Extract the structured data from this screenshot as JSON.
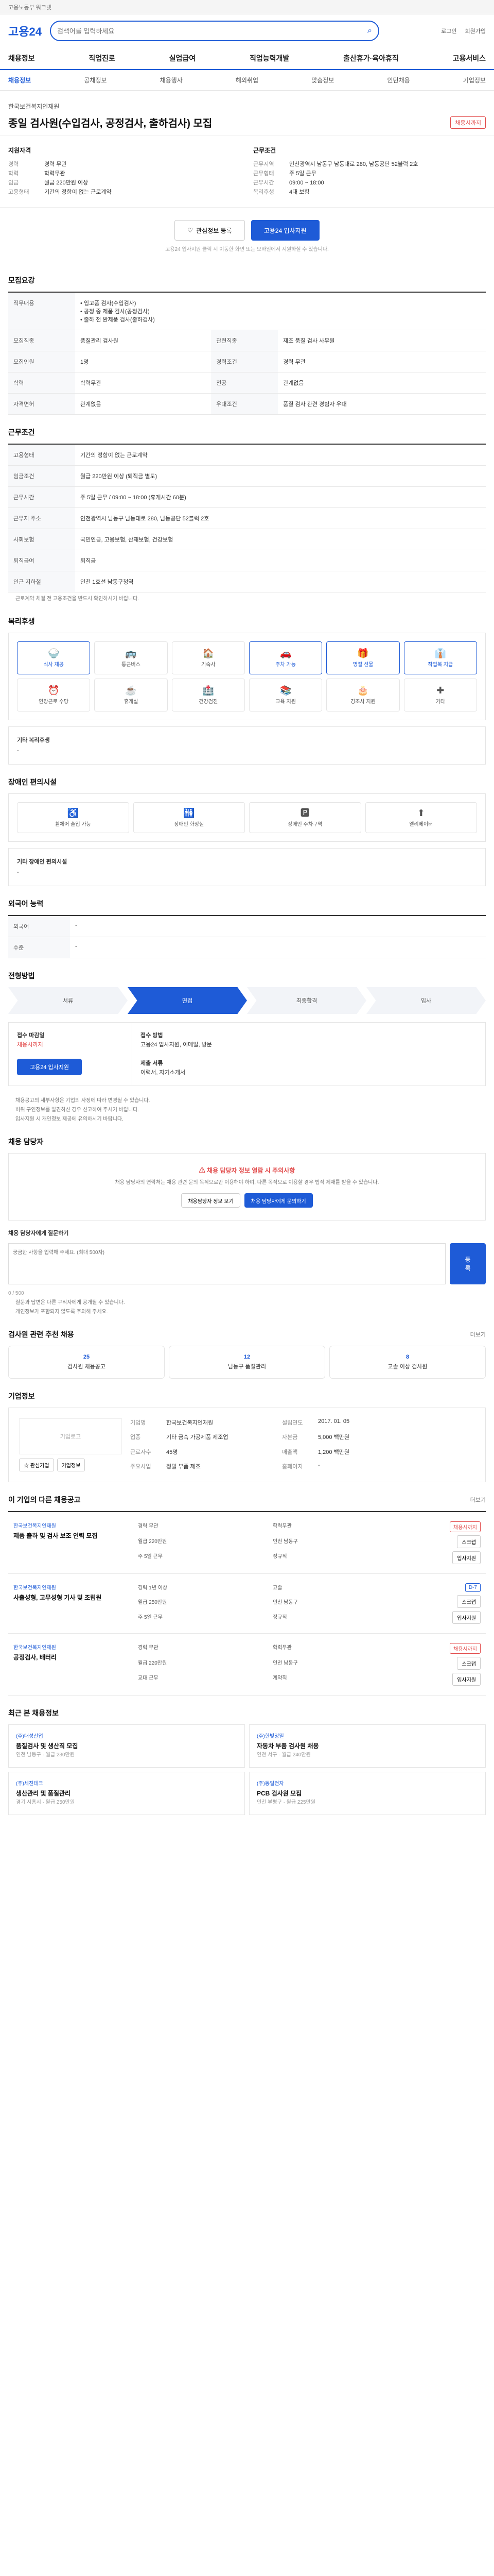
{
  "topbar": {
    "text": "고용노동부 워크넷"
  },
  "header": {
    "logo": "고용24",
    "search_placeholder": "검색어를 입력하세요",
    "login": "로그인",
    "join": "회원가입"
  },
  "gnb": [
    "채용정보",
    "직업진로",
    "실업급여",
    "직업능력개발",
    "출산휴가·육아휴직",
    "고용서비스"
  ],
  "subnav": {
    "items": [
      "채용정보",
      "공채정보",
      "채용행사",
      "해외취업",
      "맞춤정보",
      "인턴채용",
      "기업정보"
    ],
    "active_index": 0
  },
  "job": {
    "org": "한국보건복지인재원",
    "title": "종일 검사원(수입검사, 공정검사, 출하검사) 모집",
    "status": "채용시까지",
    "left_title": "지원자격",
    "left": [
      {
        "k": "경력",
        "v": "경력 무관"
      },
      {
        "k": "학력",
        "v": "학력무관"
      },
      {
        "k": "임금",
        "v": "월급 220만원 이상"
      },
      {
        "k": "고용형태",
        "v": "기간의 정함이 없는 근로계약"
      }
    ],
    "right_title": "근무조건",
    "right": [
      {
        "k": "근무지역",
        "v": "인천광역시 남동구 남동대로 280, 남동공단 52블럭 2호"
      },
      {
        "k": "근무형태",
        "v": "주 5일 근무"
      },
      {
        "k": "근무시간",
        "v": "09:00 ~ 18:00"
      },
      {
        "k": "복리후생",
        "v": "4대 보험"
      }
    ],
    "btn_save": "관심정보 등록",
    "btn_apply": "고용24 입사지원",
    "note": "고용24 입사지원 클릭 시 이동한 화면 또는 모바일에서 지원하실 수 있습니다."
  },
  "sections": {
    "requirements": "모집요강",
    "conditions": "근무조건",
    "welfare": "복리후생",
    "disability": "장애인 편의시설",
    "lang": "외국어 능력",
    "process": "전형방법",
    "contact": "채용 담당자",
    "reco": "검사원 관련 추천 채용",
    "company": "기업정보",
    "other_jobs": "이 기업의 다른 채용공고",
    "recent": "최근 본 채용정보"
  },
  "requirements": {
    "duty_label": "직무내용",
    "duty": "• 입고품 검사(수입검사)\n• 공정 중 제품 검사(공정검사)\n• 출하 전 완제품 검사(출하검사)",
    "rows": [
      {
        "k": "모집직종",
        "v": "품질관리 검사원"
      },
      {
        "k": "관련직종",
        "v": "제조 품질 검사 사무원"
      },
      {
        "k": "모집인원",
        "v": "1명"
      },
      {
        "k": "경력조건",
        "v": "경력 무관"
      },
      {
        "k": "학력",
        "v": "학력무관"
      },
      {
        "k": "전공",
        "v": "관계없음"
      },
      {
        "k": "자격면허",
        "v": "관계없음"
      },
      {
        "k": "우대조건",
        "v": "품질 검사 관련 경험자 우대"
      }
    ]
  },
  "conditions": {
    "rows": [
      {
        "k": "고용형태",
        "v": "기간의 정함이 없는 근로계약"
      },
      {
        "k": "임금조건",
        "v": "월급 220만원 이상 (퇴직금 별도)"
      },
      {
        "k": "근무시간",
        "v": "주 5일 근무 / 09:00 ~ 18:00 (휴게시간 60분)"
      },
      {
        "k": "근무지 주소",
        "v": "인천광역시 남동구 남동대로 280, 남동공단 52블럭 2호"
      },
      {
        "k": "사회보험",
        "v": "국민연금, 고용보험, 산재보험, 건강보험"
      },
      {
        "k": "퇴직급여",
        "v": "퇴직금"
      },
      {
        "k": "인근 지하철",
        "v": "인천 1호선 남동구청역"
      }
    ],
    "footnote": "근로계약 체결 전 고용조건을 반드시 확인하시기 바랍니다."
  },
  "welfare": {
    "items": [
      {
        "icon": "🍚",
        "label": "식사 제공",
        "on": true
      },
      {
        "icon": "🚌",
        "label": "통근버스",
        "on": false
      },
      {
        "icon": "🏠",
        "label": "기숙사",
        "on": false
      },
      {
        "icon": "🚗",
        "label": "주차 가능",
        "on": true
      },
      {
        "icon": "🎁",
        "label": "명절 선물",
        "on": true
      },
      {
        "icon": "👔",
        "label": "작업복 지급",
        "on": true
      },
      {
        "icon": "⏰",
        "label": "연장근로 수당",
        "on": false
      },
      {
        "icon": "☕",
        "label": "휴게실",
        "on": false
      },
      {
        "icon": "🏥",
        "label": "건강검진",
        "on": false
      },
      {
        "icon": "📚",
        "label": "교육 지원",
        "on": false
      },
      {
        "icon": "🎂",
        "label": "경조사 지원",
        "on": false
      },
      {
        "icon": "✚",
        "label": "기타",
        "on": false
      }
    ],
    "etc_label": "기타 복리후생",
    "etc_value": "-"
  },
  "disability": {
    "items": [
      {
        "icon": "♿",
        "label": "휠체어 출입 가능"
      },
      {
        "icon": "🚻",
        "label": "장애인 화장실"
      },
      {
        "icon": "🅿",
        "label": "장애인 주차구역"
      },
      {
        "icon": "⬆",
        "label": "엘리베이터"
      }
    ],
    "etc_label": "기타 장애인 편의시설",
    "etc_value": "-"
  },
  "lang": {
    "rows": [
      {
        "k": "외국어",
        "v": "-"
      },
      {
        "k": "수준",
        "v": "-"
      }
    ]
  },
  "process": {
    "steps": [
      "서류",
      "면접",
      "최종합격",
      "입사"
    ],
    "active": 1,
    "apply_left_title": "접수 마감일",
    "apply_left_value": "채용시까지",
    "apply_btn": "고용24 입사지원",
    "apply_right_title": "접수 방법",
    "apply_right_value": "고용24 입사지원, 이메일, 방문",
    "doc_title": "제출 서류",
    "doc_value": "이력서, 자기소개서",
    "bullets": [
      "채용공고의 세부사항은 기업의 사정에 따라 변경될 수 있습니다.",
      "허위 구인정보를 발견하신 경우 신고하여 주시기 바랍니다.",
      "입사지원 시 개인정보 제공에 유의하시기 바랍니다."
    ]
  },
  "contact": {
    "warn_title": "채용 담당자 정보 열람 시 주의사항",
    "warn_desc": "채용 담당자의 연락처는 채용 관련 문의 목적으로만 이용해야 하며, 다른 목적으로 이용할 경우 법적 제재를 받을 수 있습니다.",
    "btn1": "채용담당자 정보 보기",
    "btn2": "채용 담당자에게 문의하기",
    "qa_label": "채용 담당자에게 질문하기",
    "qa_placeholder": "궁금한 사항을 입력해 주세요. (최대 500자)",
    "qa_btn": "등록",
    "qa_count": "0 / 500",
    "bullets": [
      "질문과 답변은 다른 구직자에게 공개될 수 있습니다.",
      "개인정보가 포함되지 않도록 주의해 주세요."
    ]
  },
  "reco": {
    "more": "더보기",
    "items": [
      {
        "num": "25",
        "label": "검사원 채용공고"
      },
      {
        "num": "12",
        "label": "남동구 품질관리"
      },
      {
        "num": "8",
        "label": "고졸 이상 검사원"
      }
    ]
  },
  "company": {
    "logo_text": "기업로고",
    "rows": [
      {
        "k": "기업명",
        "v": "한국보건복지인재원"
      },
      {
        "k": "업종",
        "v": "기타 금속 가공제품 제조업"
      },
      {
        "k": "근로자수",
        "v": "45명"
      },
      {
        "k": "설립연도",
        "v": "2017. 01. 05"
      },
      {
        "k": "자본금",
        "v": "5,000 백만원"
      },
      {
        "k": "매출액",
        "v": "1,200 백만원"
      },
      {
        "k": "주요사업",
        "v": "정밀 부품 제조"
      },
      {
        "k": "홈페이지",
        "v": "-"
      }
    ],
    "btn_follow": "관심기업",
    "btn_info": "기업정보"
  },
  "other_jobs": {
    "more": "더보기",
    "items": [
      {
        "org": "한국보건복지인재원",
        "title": "제품 출하 및 검사 보조 인력 모집",
        "meta": [
          "경력 무관",
          "학력무관",
          "월급 220만원",
          "인천 남동구",
          "주 5일 근무",
          "정규직"
        ],
        "badge": "채용시까지",
        "badge_color": "red"
      },
      {
        "org": "한국보건복지인재원",
        "title": "사출성형, 고무성형 기사 및 조립원",
        "meta": [
          "경력 1년 이상",
          "고졸",
          "월급 250만원",
          "인천 남동구",
          "주 5일 근무",
          "정규직"
        ],
        "badge": "D-7",
        "badge_color": "blue"
      },
      {
        "org": "한국보건복지인재원",
        "title": "공정검사, 배터리",
        "meta": [
          "경력 무관",
          "학력무관",
          "월급 220만원",
          "인천 남동구",
          "교대 근무",
          "계약직"
        ],
        "badge": "채용시까지",
        "badge_color": "red"
      }
    ],
    "btn_scrap": "스크랩",
    "btn_apply": "입사지원"
  },
  "recent": {
    "items": [
      {
        "org": "(주)대성산업",
        "title": "품질검사 및 생산직 모집",
        "meta": "인천 남동구 · 월급 230만원"
      },
      {
        "org": "(주)한빛정밀",
        "title": "자동차 부품 검사원 채용",
        "meta": "인천 서구 · 월급 240만원"
      },
      {
        "org": "(주)세진테크",
        "title": "생산관리 및 품질관리",
        "meta": "경기 시흥시 · 월급 250만원"
      },
      {
        "org": "(주)동일전자",
        "title": "PCB 검사원 모집",
        "meta": "인천 부평구 · 월급 225만원"
      }
    ]
  }
}
